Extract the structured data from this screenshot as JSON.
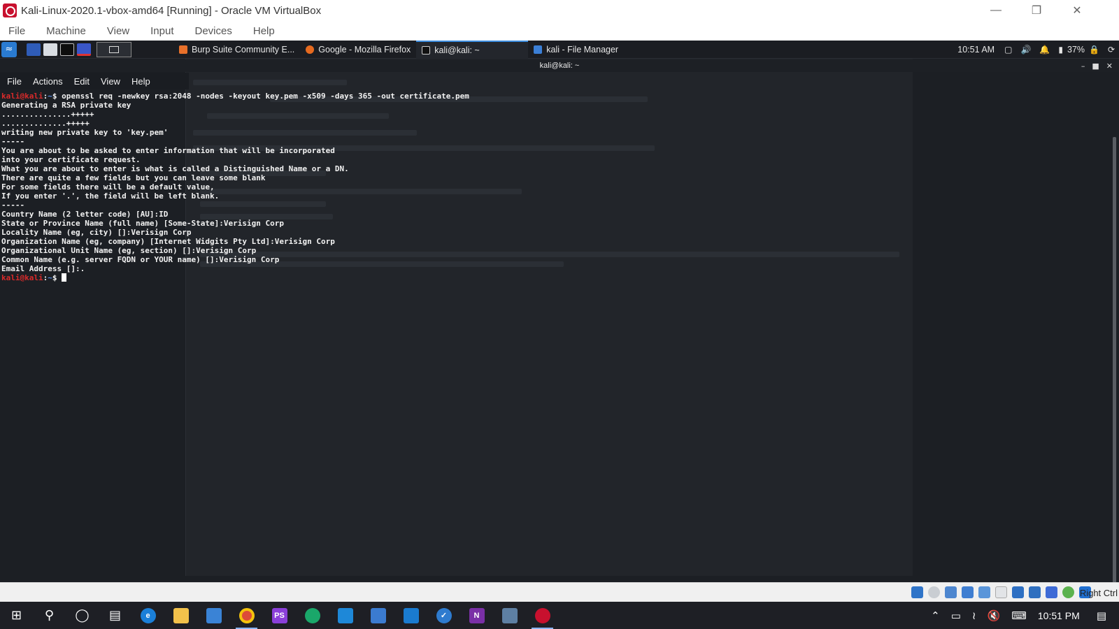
{
  "vbox": {
    "title": "Kali-Linux-2020.1-vbox-amd64 [Running] - Oracle VM VirtualBox",
    "menu": [
      "File",
      "Machine",
      "View",
      "Input",
      "Devices",
      "Help"
    ],
    "host_key": "Right Ctrl"
  },
  "guest_panel": {
    "tasks": [
      {
        "label": "Burp Suite Community E...",
        "active": false
      },
      {
        "label": "Google - Mozilla Firefox",
        "active": false
      },
      {
        "label": "kali@kali: ~",
        "active": true
      },
      {
        "label": "kali - File Manager",
        "active": false
      }
    ],
    "clock": "10:51 AM",
    "battery": "37%"
  },
  "terminal": {
    "title": "kali@kali: ~",
    "menu": [
      "File",
      "Actions",
      "Edit",
      "View",
      "Help"
    ],
    "prompt_user": "kali@kali",
    "prompt_sep": ":",
    "prompt_path": "~",
    "prompt_sym": "$ ",
    "command": "openssl req -newkey rsa:2048 -nodes -keyout key.pem -x509 -days 365 -out certificate.pem",
    "output": [
      "Generating a RSA private key",
      "...............+++++",
      "..............+++++",
      "writing new private key to 'key.pem'",
      "-----",
      "You are about to be asked to enter information that will be incorporated",
      "into your certificate request.",
      "What you are about to enter is what is called a Distinguished Name or a DN.",
      "There are quite a few fields but you can leave some blank",
      "For some fields there will be a default value,",
      "If you enter '.', the field will be left blank.",
      "-----",
      "Country Name (2 letter code) [AU]:ID",
      "State or Province Name (full name) [Some-State]:Verisign Corp",
      "Locality Name (eg, city) []:Verisign Corp",
      "Organization Name (eg, company) [Internet Widgits Pty Ltd]:Verisign Corp",
      "Organizational Unit Name (eg, section) []:Verisign Corp",
      "Common Name (e.g. server FQDN or YOUR name) []:Verisign Corp",
      "Email Address []:."
    ]
  },
  "win_taskbar": {
    "clock": "10:51 PM"
  }
}
